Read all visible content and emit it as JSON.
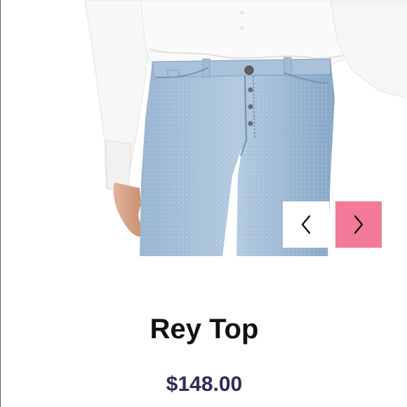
{
  "product": {
    "title": "Rey Top",
    "price": "$148.00"
  },
  "carousel": {
    "prev_icon": "chevron-left-icon",
    "next_icon": "chevron-right-icon"
  },
  "colors": {
    "price": "#2b2d5b",
    "next_button": "#f27a98",
    "prev_button": "#ffffff",
    "denim": "#8fb0ce"
  }
}
